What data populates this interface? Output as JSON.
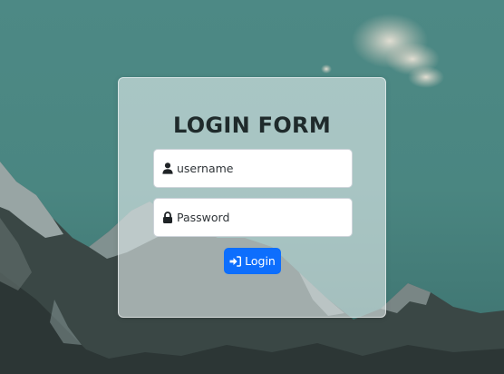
{
  "page": {
    "background": "teal sky with snow-capped mountain range",
    "accent_color": "#0d6efd"
  },
  "login_form": {
    "title": "LOGIN FORM",
    "username": {
      "placeholder": "username",
      "value": "",
      "icon": "user-icon"
    },
    "password": {
      "placeholder": "Password",
      "value": "",
      "icon": "lock-icon"
    },
    "submit": {
      "label": "Login",
      "icon": "sign-in-icon"
    }
  }
}
